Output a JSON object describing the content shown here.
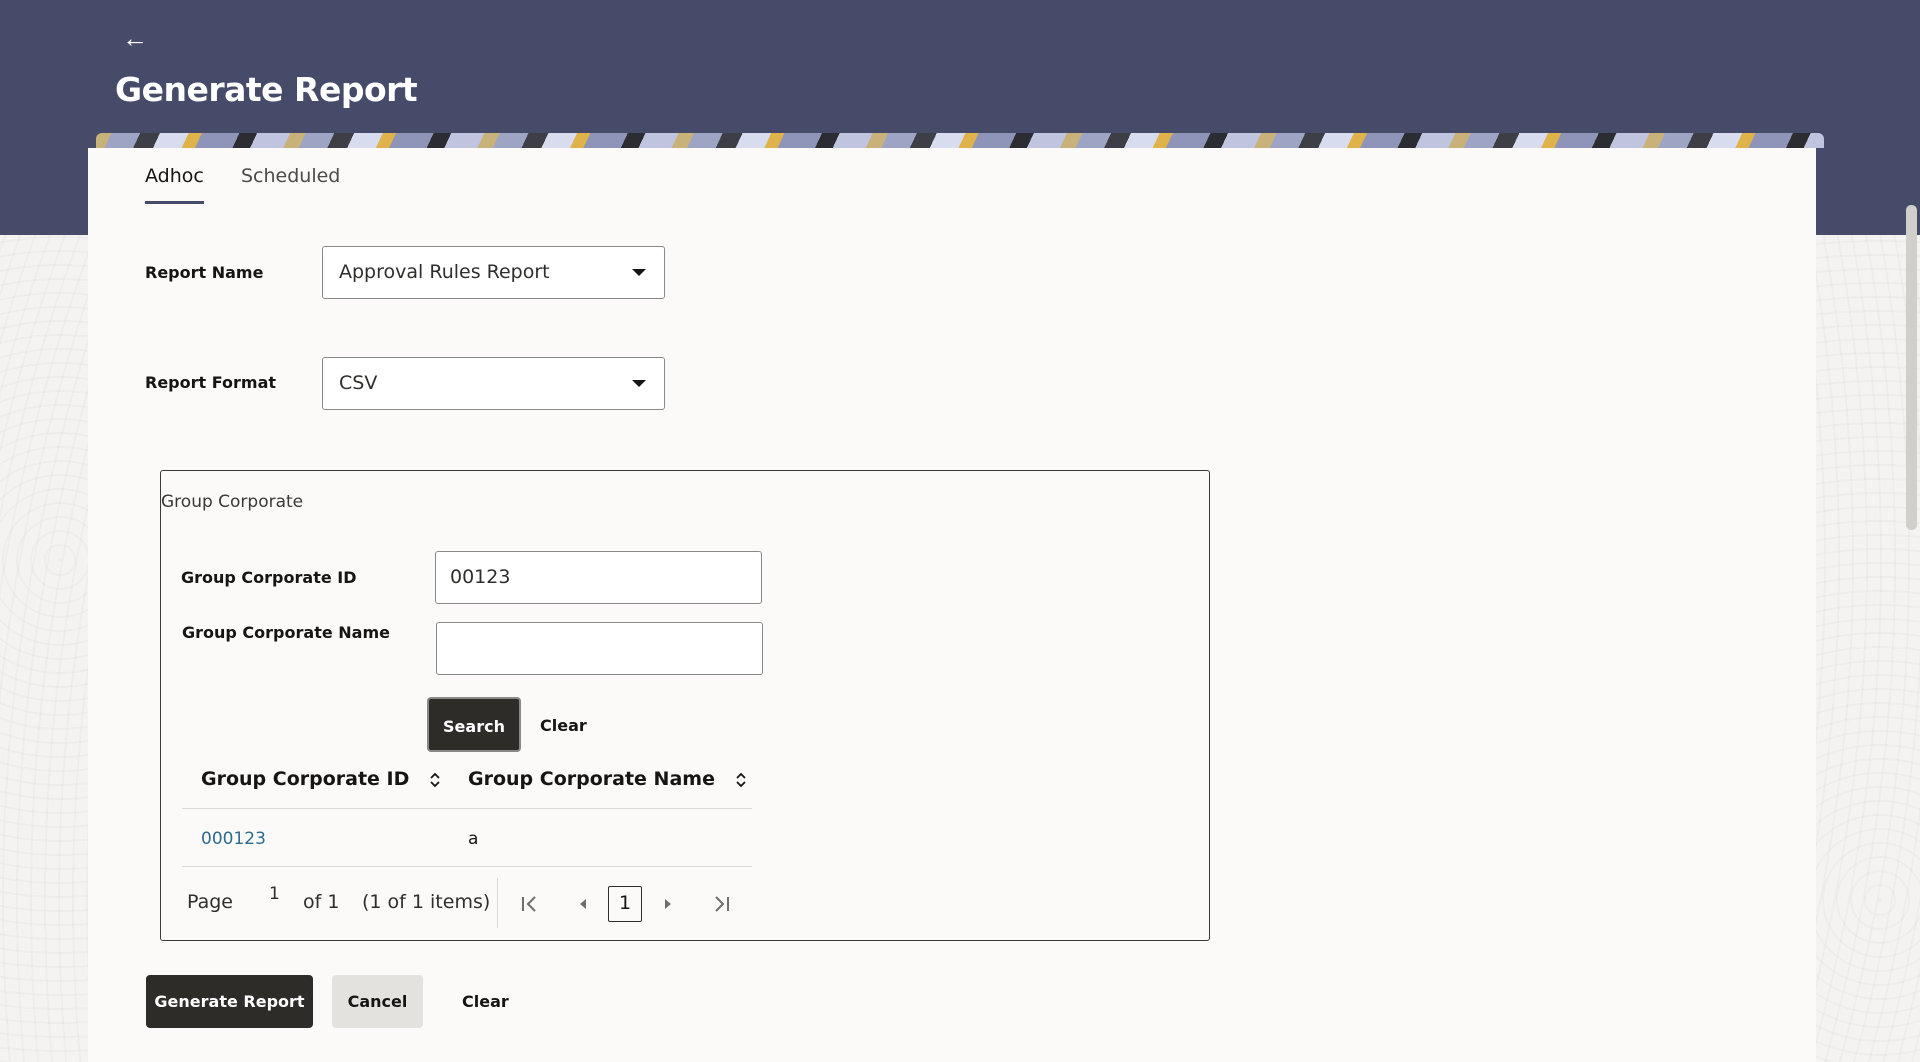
{
  "header": {
    "title": "Generate Report",
    "back_icon": "arrow-left-icon"
  },
  "tabs": [
    {
      "label": "Adhoc",
      "active": true
    },
    {
      "label": "Scheduled",
      "active": false
    }
  ],
  "form": {
    "report_name_label": "Report Name",
    "report_name_value": "Approval Rules Report",
    "report_format_label": "Report Format",
    "report_format_value": "CSV"
  },
  "group_corporate": {
    "title": "Group Corporate",
    "id_label": "Group Corporate ID",
    "id_value": "00123",
    "name_label": "Group Corporate Name",
    "name_value": "",
    "search_label": "Search",
    "clear_label": "Clear"
  },
  "table": {
    "headers": [
      "Group Corporate ID",
      "Group Corporate Name"
    ],
    "rows": [
      {
        "id": "000123",
        "name": "a"
      }
    ]
  },
  "pager": {
    "page_label": "Page",
    "current_page": "1",
    "of_text": "of 1",
    "items_text": "(1 of 1 items)",
    "page_box": "1"
  },
  "actions": {
    "generate_label": "Generate Report",
    "cancel_label": "Cancel",
    "clear_label": "Clear"
  },
  "colors": {
    "header_bg": "#474b6a",
    "primary_button": "#2e2c29",
    "link": "#2d6a8f"
  }
}
